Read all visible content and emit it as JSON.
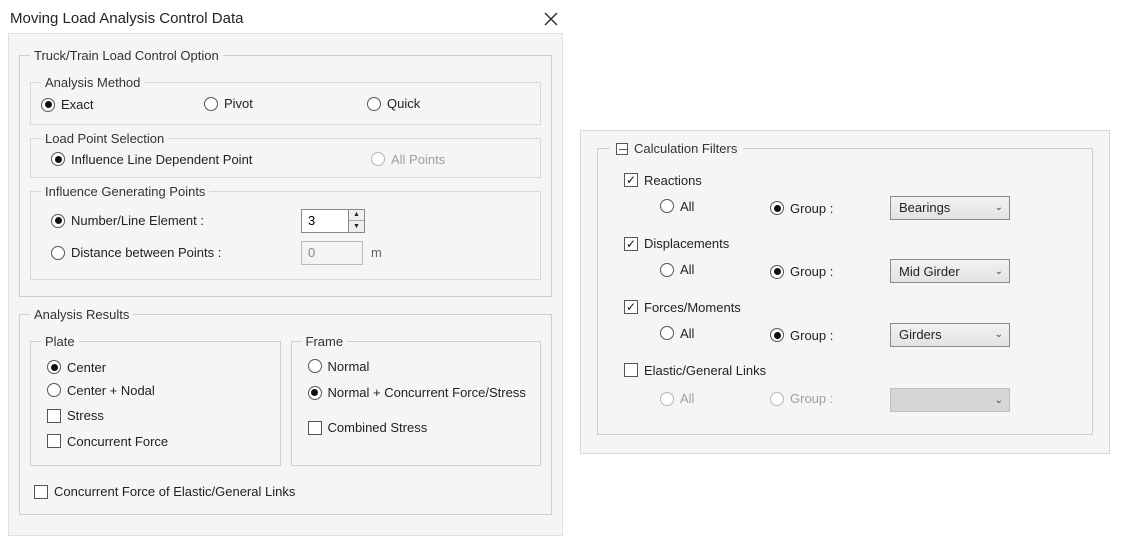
{
  "dialog": {
    "title": "Moving Load Analysis Control Data"
  },
  "truckTrain": {
    "legend": "Truck/Train Load Control Option",
    "method": {
      "legend": "Analysis Method",
      "exact": "Exact",
      "pivot": "Pivot",
      "quick": "Quick"
    },
    "lps": {
      "legend": "Load Point Selection",
      "influence": "Influence Line Dependent Point",
      "all": "All Points"
    },
    "igp": {
      "legend": "Influence Generating Points",
      "numberLabel": "Number/Line Element :",
      "numberValue": "3",
      "distLabel": "Distance between Points :",
      "distValue": "0",
      "unit": "m"
    }
  },
  "results": {
    "legend": "Analysis Results",
    "plate": {
      "legend": "Plate",
      "center": "Center",
      "centerNodal": "Center + Nodal",
      "stress": "Stress",
      "concurrent": "Concurrent Force"
    },
    "frame": {
      "legend": "Frame",
      "normal": "Normal",
      "normalConc": "Normal + Concurrent Force/Stress",
      "combined": "Combined Stress"
    },
    "concurrentLinks": "Concurrent Force of Elastic/General Links"
  },
  "filters": {
    "legend": "Calculation Filters",
    "allLabel": "All",
    "groupLabel": "Group :",
    "reactions": {
      "label": "Reactions",
      "combo": "Bearings"
    },
    "displacements": {
      "label": "Displacements",
      "combo": "Mid Girder"
    },
    "forces": {
      "label": "Forces/Moments",
      "combo": "Girders"
    },
    "elastic": {
      "label": "Elastic/General Links",
      "combo": ""
    }
  }
}
